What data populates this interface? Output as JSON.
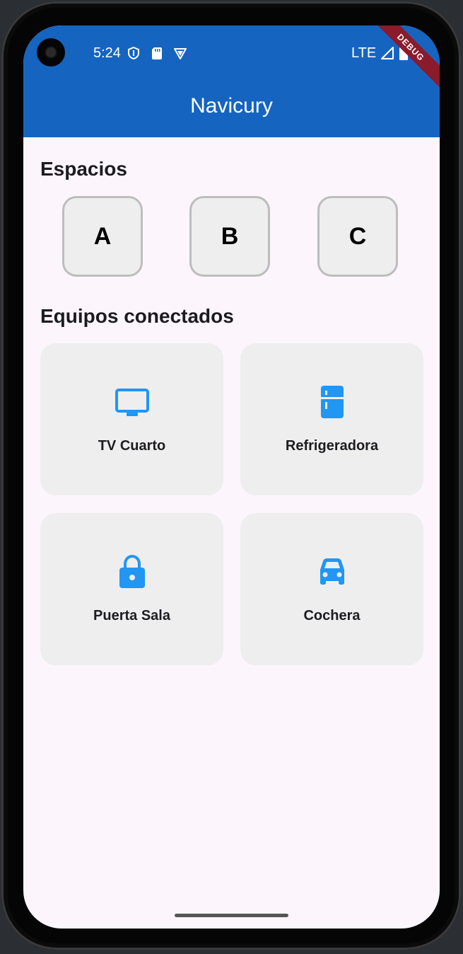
{
  "status_bar": {
    "time": "5:24",
    "network": "LTE",
    "icons": [
      "vpn-shield-icon",
      "sd-card-icon",
      "app-notification-icon",
      "signal-icon",
      "battery-icon"
    ]
  },
  "debug_banner": "DEBUG",
  "app_bar": {
    "title": "Navicury",
    "color": "#1565c0"
  },
  "spaces": {
    "title": "Espacios",
    "items": [
      {
        "label": "A"
      },
      {
        "label": "B"
      },
      {
        "label": "C"
      }
    ]
  },
  "devices": {
    "title": "Equipos conectados",
    "icon_color": "#2196f3",
    "items": [
      {
        "label": "TV Cuarto",
        "icon": "tv-icon"
      },
      {
        "label": "Refrigeradora",
        "icon": "fridge-icon"
      },
      {
        "label": "Puerta Sala",
        "icon": "lock-icon"
      },
      {
        "label": "Cochera",
        "icon": "car-icon"
      }
    ]
  }
}
